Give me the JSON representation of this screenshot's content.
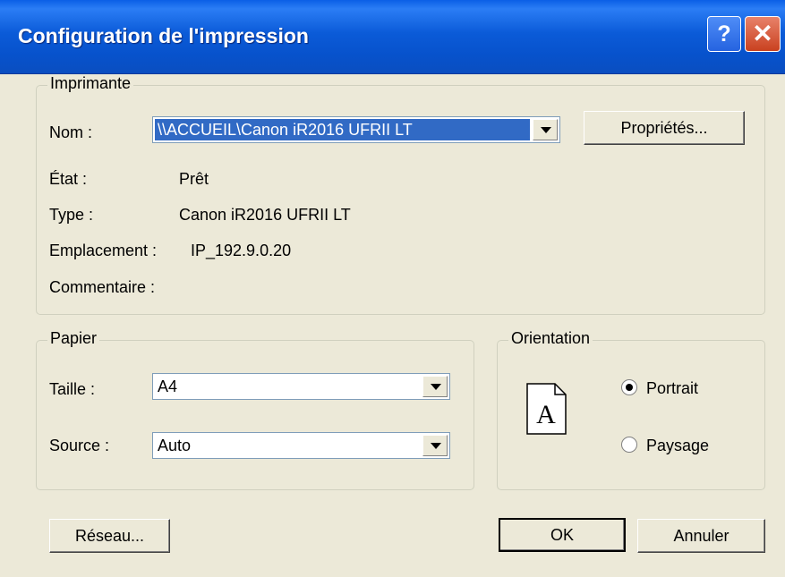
{
  "window": {
    "title": "Configuration de l'impression",
    "help_label": "?",
    "close_label": "✕"
  },
  "printer": {
    "group_label": "Imprimante",
    "name_label": "Nom :",
    "name_value": "\\\\ACCUEIL\\Canon iR2016 UFRII LT",
    "properties_button": "Propriétés...",
    "state_label": "État :",
    "state_value": "Prêt",
    "type_label": "Type :",
    "type_value": "Canon iR2016 UFRII LT",
    "location_label": "Emplacement :",
    "location_value": "IP_192.9.0.20",
    "comment_label": "Commentaire :",
    "comment_value": ""
  },
  "paper": {
    "group_label": "Papier",
    "size_label": "Taille :",
    "size_value": "A4",
    "source_label": "Source :",
    "source_value": "Auto"
  },
  "orientation": {
    "group_label": "Orientation",
    "icon_letter": "A",
    "selected": "portrait",
    "portrait_label": "Portrait",
    "landscape_label": "Paysage"
  },
  "buttons": {
    "network": "Réseau...",
    "ok": "OK",
    "cancel": "Annuler"
  }
}
